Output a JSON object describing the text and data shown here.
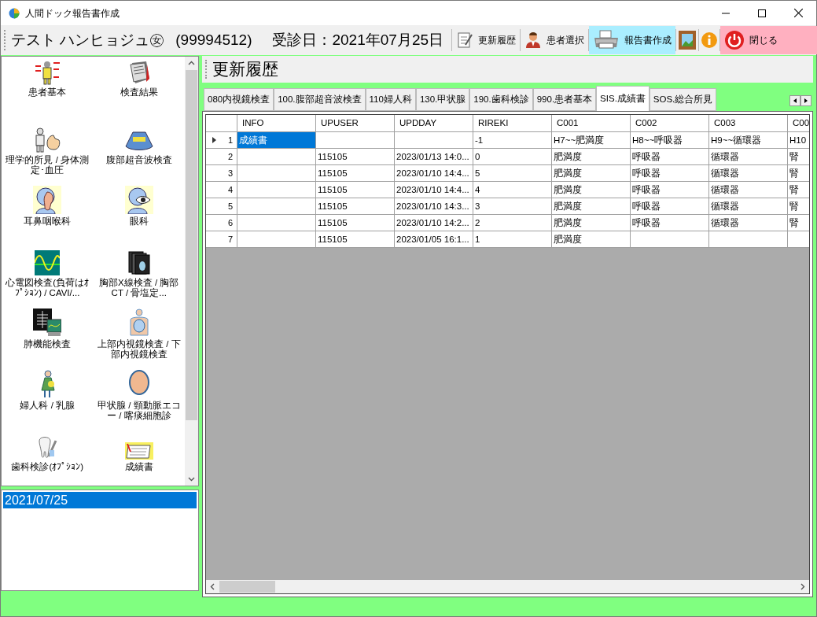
{
  "window": {
    "title": "人間ドック報告書作成"
  },
  "toolbar": {
    "patient_name": "テスト ハンヒョジュ㊛",
    "patient_id": "(99994512)",
    "exam_date": "受診日：2021年07月25日",
    "buttons": [
      {
        "label": "更新履歴",
        "kind": "history",
        "highlighted": false
      },
      {
        "label": "患者選択",
        "kind": "patient",
        "highlighted": false
      },
      {
        "label": "報告書作成",
        "kind": "printer",
        "highlighted": true
      },
      {
        "kind": "frame",
        "highlighted": false
      },
      {
        "kind": "info",
        "highlighted": false
      },
      {
        "label": "閉じる",
        "kind": "power",
        "highlighted": true
      }
    ]
  },
  "sidebar": {
    "items": [
      {
        "label": "患者基本"
      },
      {
        "label": "検査結果"
      },
      {
        "label": "理学的所見 / 身体測定･血圧"
      },
      {
        "label": "腹部超音波検査"
      },
      {
        "label": "耳鼻咽喉科"
      },
      {
        "label": "眼科"
      },
      {
        "label": "心電図検査(負荷はｵﾌﾟｼｮﾝ) / CAVI/..."
      },
      {
        "label": "胸部X線検査 / 胸部CT / 骨塩定..."
      },
      {
        "label": "肺機能検査"
      },
      {
        "label": "上部内視鏡検査 / 下部内視鏡検査"
      },
      {
        "label": "婦人科 / 乳腺"
      },
      {
        "label": "甲状腺 / 頸動脈エコー / 喀痰細胞診"
      },
      {
        "label": "歯科検診(ｵﾌﾟｼｮﾝ)"
      },
      {
        "label": "成績書"
      }
    ]
  },
  "dates": [
    {
      "label": "2021/07/25",
      "selected": true
    }
  ],
  "panel": {
    "title": "更新履歴"
  },
  "tabs": [
    {
      "label": "080内視鏡検査",
      "selected": false
    },
    {
      "label": "100.腹部超音波検査",
      "selected": false
    },
    {
      "label": "110婦人科",
      "selected": false
    },
    {
      "label": "130.甲状腺",
      "selected": false
    },
    {
      "label": "190.歯科検診",
      "selected": false
    },
    {
      "label": "990.患者基本",
      "selected": false
    },
    {
      "label": "SIS.成績書",
      "selected": true
    },
    {
      "label": "SOS.総合所見",
      "selected": false
    }
  ],
  "table": {
    "columns": [
      "INFO",
      "UPUSER",
      "UPDDAY",
      "RIREKI",
      "C001",
      "C002",
      "C003",
      "C00"
    ],
    "rows": [
      {
        "number": "1",
        "current": true,
        "cells": [
          "成績書",
          "",
          "",
          "-1",
          "H7~~肥満度",
          "H8~~呼吸器",
          "H9~~循環器",
          "H10"
        ]
      },
      {
        "number": "2",
        "current": false,
        "cells": [
          "",
          "115105",
          "2023/01/13 14:0...",
          "0",
          "肥満度",
          "呼吸器",
          "循環器",
          "腎"
        ]
      },
      {
        "number": "3",
        "current": false,
        "cells": [
          "",
          "115105",
          "2023/01/10 14:4...",
          "5",
          "肥満度",
          "呼吸器",
          "循環器",
          "腎"
        ]
      },
      {
        "number": "4",
        "current": false,
        "cells": [
          "",
          "115105",
          "2023/01/10 14:4...",
          "4",
          "肥満度",
          "呼吸器",
          "循環器",
          "腎"
        ]
      },
      {
        "number": "5",
        "current": false,
        "cells": [
          "",
          "115105",
          "2023/01/10 14:3...",
          "3",
          "肥満度",
          "呼吸器",
          "循環器",
          "腎"
        ]
      },
      {
        "number": "6",
        "current": false,
        "cells": [
          "",
          "115105",
          "2023/01/10 14:2...",
          "2",
          "肥満度",
          "呼吸器",
          "循環器",
          "腎"
        ]
      },
      {
        "number": "7",
        "current": false,
        "cells": [
          "",
          "115105",
          "2023/01/05 16:1...",
          "1",
          "肥満度",
          "",
          "",
          ""
        ]
      }
    ]
  }
}
